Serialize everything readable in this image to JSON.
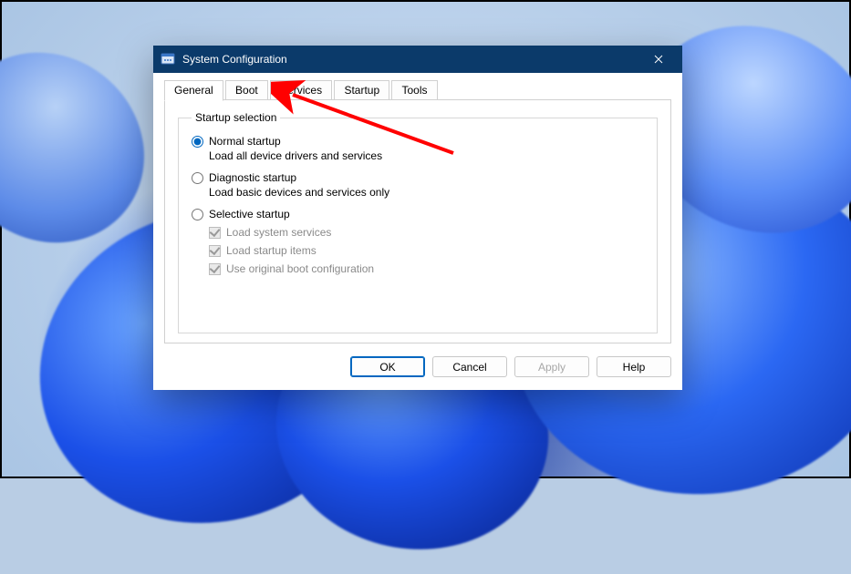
{
  "window": {
    "title": "System Configuration"
  },
  "tabs": {
    "items": [
      {
        "label": "General",
        "active": true
      },
      {
        "label": "Boot",
        "active": false
      },
      {
        "label": "Services",
        "active": false
      },
      {
        "label": "Startup",
        "active": false
      },
      {
        "label": "Tools",
        "active": false
      }
    ]
  },
  "general": {
    "group_label": "Startup selection",
    "options": [
      {
        "key": "normal",
        "label": "Normal startup",
        "description": "Load all device drivers and services",
        "selected": true
      },
      {
        "key": "diagnostic",
        "label": "Diagnostic startup",
        "description": "Load basic devices and services only",
        "selected": false
      },
      {
        "key": "selective",
        "label": "Selective startup",
        "description": "",
        "selected": false,
        "sub": [
          {
            "label": "Load system services",
            "checked": true,
            "enabled": false
          },
          {
            "label": "Load startup items",
            "checked": true,
            "enabled": false
          },
          {
            "label": "Use original boot configuration",
            "checked": true,
            "enabled": false
          }
        ]
      }
    ]
  },
  "buttons": {
    "ok": "OK",
    "cancel": "Cancel",
    "apply": "Apply",
    "help": "Help"
  },
  "annotation": {
    "arrow_color": "#ff0000",
    "target": "tab-startup"
  }
}
